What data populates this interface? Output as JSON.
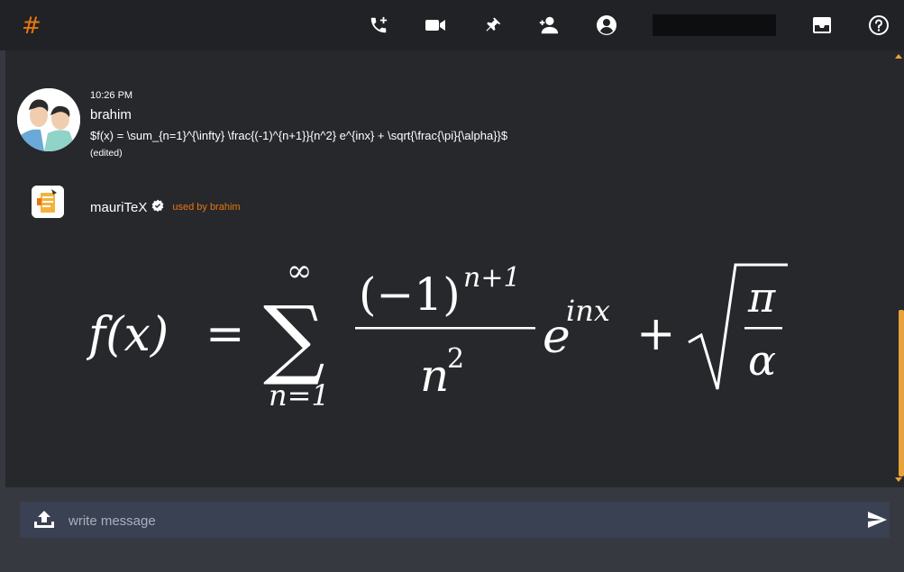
{
  "header": {
    "channel_symbol": "#",
    "icons": [
      "call-add-icon",
      "video-icon",
      "pin-icon",
      "add-user-icon",
      "profile-icon",
      "inbox-icon",
      "help-icon"
    ],
    "search_value": ""
  },
  "messages": [
    {
      "time": "10:26 PM",
      "user": "brahim",
      "text": "$f(x) = \\sum_{n=1}^{\\infty} \\frac{(-1)^{n+1}}{n^2} e^{inx} + \\sqrt{\\frac{\\pi}{\\alpha}}$",
      "edited": "(edited)"
    },
    {
      "user": "mauriTeX",
      "used_by": "used by brahim",
      "rendered_formula": {
        "lhs": "f(x)",
        "eq": "=",
        "sum_upper": "∞",
        "sum_lower": "n=1",
        "frac_num": "(−1)",
        "frac_num_exp": "n+1",
        "frac_den": "n",
        "frac_den_exp": "2",
        "exp_base": "e",
        "exp_power": "inx",
        "plus": "+",
        "sqrt_num": "π",
        "sqrt_den": "α"
      }
    }
  ],
  "composer": {
    "placeholder": "write message"
  },
  "colors": {
    "accent": "#e8760f",
    "scroll": "#e8a33a",
    "topbar": "#202225",
    "chat_bg": "#27282c",
    "composer_bg": "#3a4152"
  }
}
